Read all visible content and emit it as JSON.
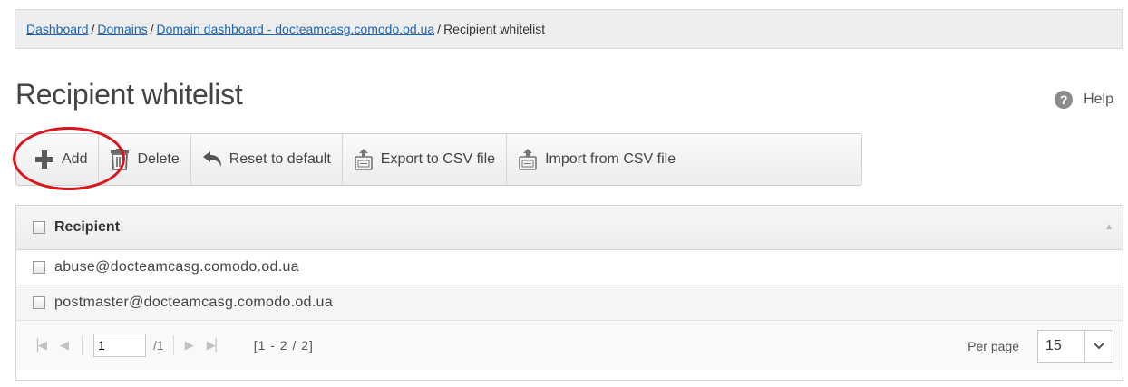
{
  "breadcrumb": {
    "items": [
      "Dashboard",
      "Domains",
      "Domain dashboard - docteamcasg.comodo.od.ua"
    ],
    "current": "Recipient whitelist",
    "separator": "/"
  },
  "page": {
    "title": "Recipient whitelist",
    "help_label": "Help",
    "help_glyph": "?"
  },
  "toolbar": {
    "add_label": "Add",
    "delete_label": "Delete",
    "reset_label": "Reset to default",
    "export_label": "Export to CSV file",
    "import_label": "Import from CSV file"
  },
  "grid": {
    "header": "Recipient",
    "rows": [
      "abuse@docteamcasg.comodo.od.ua",
      "postmaster@docteamcasg.comodo.od.ua"
    ]
  },
  "pager": {
    "page_value": "1",
    "total_pages": "/1",
    "range": "[1 - 2 / 2]",
    "per_page_label": "Per page",
    "per_page_value": "15"
  },
  "colors": {
    "link": "#1a66b8",
    "highlight_ring": "#d8161d",
    "add_icon": "#5a5a5a"
  },
  "icons": {
    "add": "plus-icon",
    "delete": "trash-icon",
    "reset": "undo-arrow-icon",
    "export": "csv-export-icon",
    "import": "csv-import-icon",
    "help": "help-icon"
  }
}
